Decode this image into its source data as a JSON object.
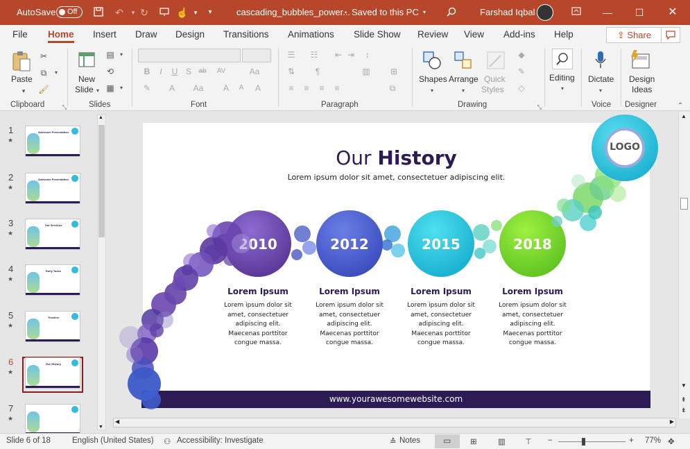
{
  "titlebar": {
    "autosave_label": "AutoSave",
    "autosave_state": "Off",
    "filename": "cascading_bubbles_power...",
    "save_status": "Saved to this PC",
    "user_name": "Farshad Iqbal"
  },
  "menu": {
    "tabs": [
      "File",
      "Home",
      "Insert",
      "Draw",
      "Design",
      "Transitions",
      "Animations",
      "Slide Show",
      "Review",
      "View",
      "Add-ins",
      "Help"
    ],
    "active": "Home",
    "share_label": "Share"
  },
  "ribbon": {
    "paste_label": "Paste",
    "new_slide_label_1": "New",
    "new_slide_label_2": "Slide",
    "shapes_label": "Shapes",
    "arrange_label": "Arrange",
    "quick_styles_1": "Quick",
    "quick_styles_2": "Styles",
    "editing_label": "Editing",
    "dictate_label": "Dictate",
    "design_ideas_1": "Design",
    "design_ideas_2": "Ideas",
    "groups": {
      "clipboard": "Clipboard",
      "slides": "Slides",
      "font": "Font",
      "paragraph": "Paragraph",
      "drawing": "Drawing",
      "voice": "Voice",
      "designer": "Designer"
    }
  },
  "thumbnails": [
    {
      "num": "1",
      "title": "Awesome Presentation"
    },
    {
      "num": "2",
      "title": "Awesome Presentation"
    },
    {
      "num": "3",
      "title": "Our Services"
    },
    {
      "num": "4",
      "title": "Early Tasks"
    },
    {
      "num": "5",
      "title": "Timeline"
    },
    {
      "num": "6",
      "title": "Our History"
    },
    {
      "num": "7",
      "title": ""
    }
  ],
  "selected_slide": "6",
  "slide": {
    "title_light": "Our ",
    "title_bold": "History",
    "subtitle": "Lorem ipsum dolor sit amet, consectetuer adipiscing elit.",
    "logo": "LOGO",
    "footer": "www.yourawesomewebsite.com",
    "milestones": [
      {
        "year": "2010",
        "heading": "Lorem Ipsum",
        "line1": "Lorem ipsum dolor sit",
        "line2": "amet, consectetuer",
        "line3": "adipiscing elit.",
        "line4": "Maecenas porttitor",
        "line5": "congue massa.",
        "color1": "#8d6bd0",
        "color2": "#4b2a8a"
      },
      {
        "year": "2012",
        "heading": "Lorem Ipsum",
        "line1": "Lorem ipsum dolor sit",
        "line2": "amet, consectetuer",
        "line3": "adipiscing elit.",
        "line4": "Maecenas porttitor",
        "line5": "congue massa.",
        "color1": "#6a7ee8",
        "color2": "#2f3fb0"
      },
      {
        "year": "2015",
        "heading": "Lorem Ipsum",
        "line1": "Lorem ipsum dolor sit",
        "line2": "amet, consectetuer",
        "line3": "adipiscing elit.",
        "line4": "Maecenas porttitor",
        "line5": "congue massa.",
        "color1": "#4fe0f0",
        "color2": "#0aa3c8"
      },
      {
        "year": "2018",
        "heading": "Lorem Ipsum",
        "line1": "Lorem ipsum dolor sit",
        "line2": "amet, consectetuer",
        "line3": "adipiscing elit.",
        "line4": "Maecenas porttitor",
        "line5": "congue massa.",
        "color1": "#9ef040",
        "color2": "#4fb81a"
      }
    ]
  },
  "status": {
    "slide_info": "Slide 6 of 18",
    "language": "English (United States)",
    "accessibility": "Accessibility: Investigate",
    "notes": "Notes",
    "zoom": "77%"
  },
  "colors": {
    "accent": "#b7472a",
    "footer_bar": "#2d1b56",
    "title_dark": "#2d1b56"
  }
}
